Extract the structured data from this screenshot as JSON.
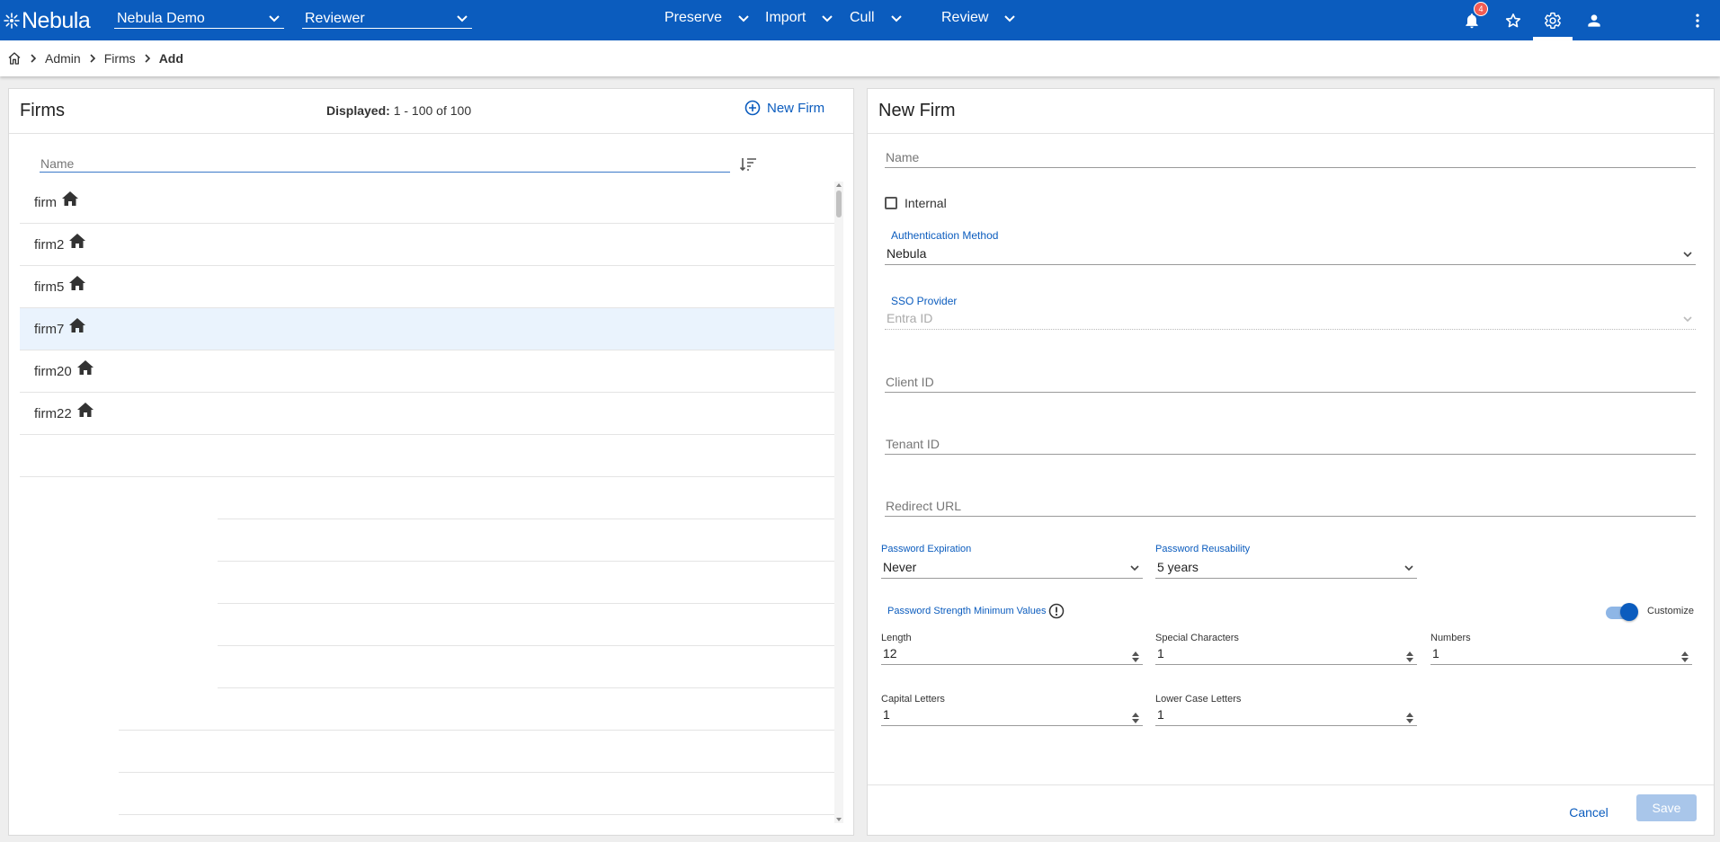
{
  "app": {
    "brand": "Nebula",
    "accent": "#0b5cbe",
    "workspace_select": "Nebula Demo",
    "role_select": "Reviewer",
    "nav": [
      "Preserve",
      "Import",
      "Cull",
      "Review"
    ],
    "notification_count": "4"
  },
  "breadcrumb": {
    "home_icon": "home-icon",
    "items": [
      "Admin",
      "Firms",
      "Add"
    ]
  },
  "firms_panel": {
    "title": "Firms",
    "displayed_label": "Displayed:",
    "displayed_value": "1 - 100 of 100",
    "new_firm_label": "New Firm",
    "filter_placeholder": "Name",
    "rows": [
      {
        "name": "firm",
        "selected": false
      },
      {
        "name": "firm2",
        "selected": false
      },
      {
        "name": "firm5",
        "selected": false
      },
      {
        "name": "firm7",
        "selected": true
      },
      {
        "name": "firm20",
        "selected": false
      },
      {
        "name": "firm22",
        "selected": false
      }
    ]
  },
  "new_firm_panel": {
    "title": "New Firm",
    "name_placeholder": "Name",
    "internal_label": "Internal",
    "auth_method_label": "Authentication Method",
    "auth_method_value": "Nebula",
    "sso_provider_label": "SSO Provider",
    "sso_provider_value": "Entra ID",
    "client_id_placeholder": "Client ID",
    "tenant_id_placeholder": "Tenant ID",
    "redirect_url_placeholder": "Redirect URL",
    "password_expiration_label": "Password Expiration",
    "password_expiration_value": "Never",
    "password_reusability_label": "Password Reusability",
    "password_reusability_value": "5 years",
    "strength_label": "Password Strength Minimum Values",
    "customize_label": "Customize",
    "customize_on": true,
    "length_label": "Length",
    "length_value": "12",
    "special_label": "Special Characters",
    "special_value": "1",
    "numbers_label": "Numbers",
    "numbers_value": "1",
    "capital_label": "Capital Letters",
    "capital_value": "1",
    "lower_label": "Lower Case Letters",
    "lower_value": "1",
    "cancel_label": "Cancel",
    "save_label": "Save"
  }
}
